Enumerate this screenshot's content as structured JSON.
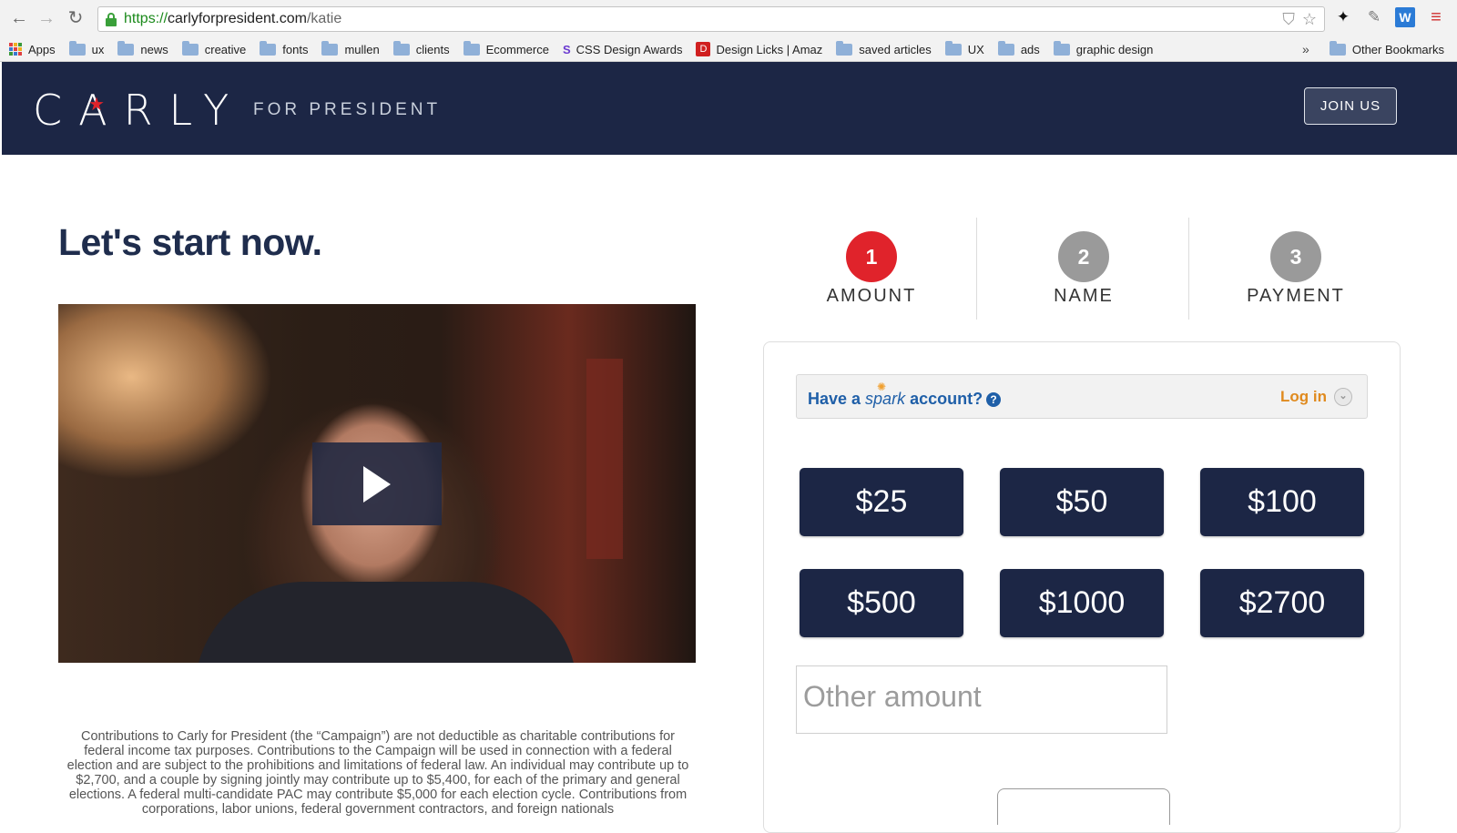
{
  "browser": {
    "url_scheme": "https://",
    "url_host": "carlyforpresident.com",
    "url_path": "/katie",
    "bookmarks": [
      {
        "label": "Apps",
        "icon": "apps-grid-icon"
      },
      {
        "label": "ux",
        "icon": "folder-icon"
      },
      {
        "label": "news",
        "icon": "folder-icon"
      },
      {
        "label": "creative",
        "icon": "folder-icon"
      },
      {
        "label": "fonts",
        "icon": "folder-icon"
      },
      {
        "label": "mullen",
        "icon": "folder-icon"
      },
      {
        "label": "clients",
        "icon": "folder-icon"
      },
      {
        "label": "Ecommerce",
        "icon": "folder-icon"
      },
      {
        "label": "CSS Design Awards",
        "icon": "css-design-awards-icon"
      },
      {
        "label": "Design Licks | Amaz",
        "icon": "design-licks-icon"
      },
      {
        "label": "saved articles",
        "icon": "folder-icon"
      },
      {
        "label": "UX",
        "icon": "folder-icon"
      },
      {
        "label": "ads",
        "icon": "folder-icon"
      },
      {
        "label": "graphic design",
        "icon": "folder-icon"
      }
    ],
    "overflow_chevron": "»",
    "other_bookmarks": "Other Bookmarks"
  },
  "header": {
    "logo": "CARLY",
    "tagline": "FOR PRESIDENT",
    "join_button": "JOIN US",
    "bg_color": "#1c2645",
    "accent_color": "#e0232b"
  },
  "main": {
    "headline": "Let's start now.",
    "disclaimer": "Contributions to Carly for President (the “Campaign”) are not deductible as charitable contributions for federal income tax purposes. Contributions to the Campaign will be used in connection with a federal election and are subject to the prohibitions and limitations of federal law. An individual may contribute up to $2,700, and a couple by signing jointly may contribute up to $5,400, for each of the primary and general elections. A federal multi-candidate PAC may contribute $5,000 for each election cycle. Contributions from corporations, labor unions, federal government contractors, and foreign nationals"
  },
  "steps": [
    {
      "number": "1",
      "label": "AMOUNT",
      "active": true,
      "color": "#e0232b"
    },
    {
      "number": "2",
      "label": "NAME",
      "active": false,
      "color": "#9a9a9a"
    },
    {
      "number": "3",
      "label": "PAYMENT",
      "active": false,
      "color": "#9a9a9a"
    }
  ],
  "form": {
    "spark_prefix": "Have a ",
    "spark_brand": "spark",
    "spark_suffix": " account?",
    "login_label": "Log in",
    "amounts": [
      "$25",
      "$50",
      "$100",
      "$500",
      "$1000",
      "$2700"
    ],
    "other_placeholder": "Other amount"
  }
}
